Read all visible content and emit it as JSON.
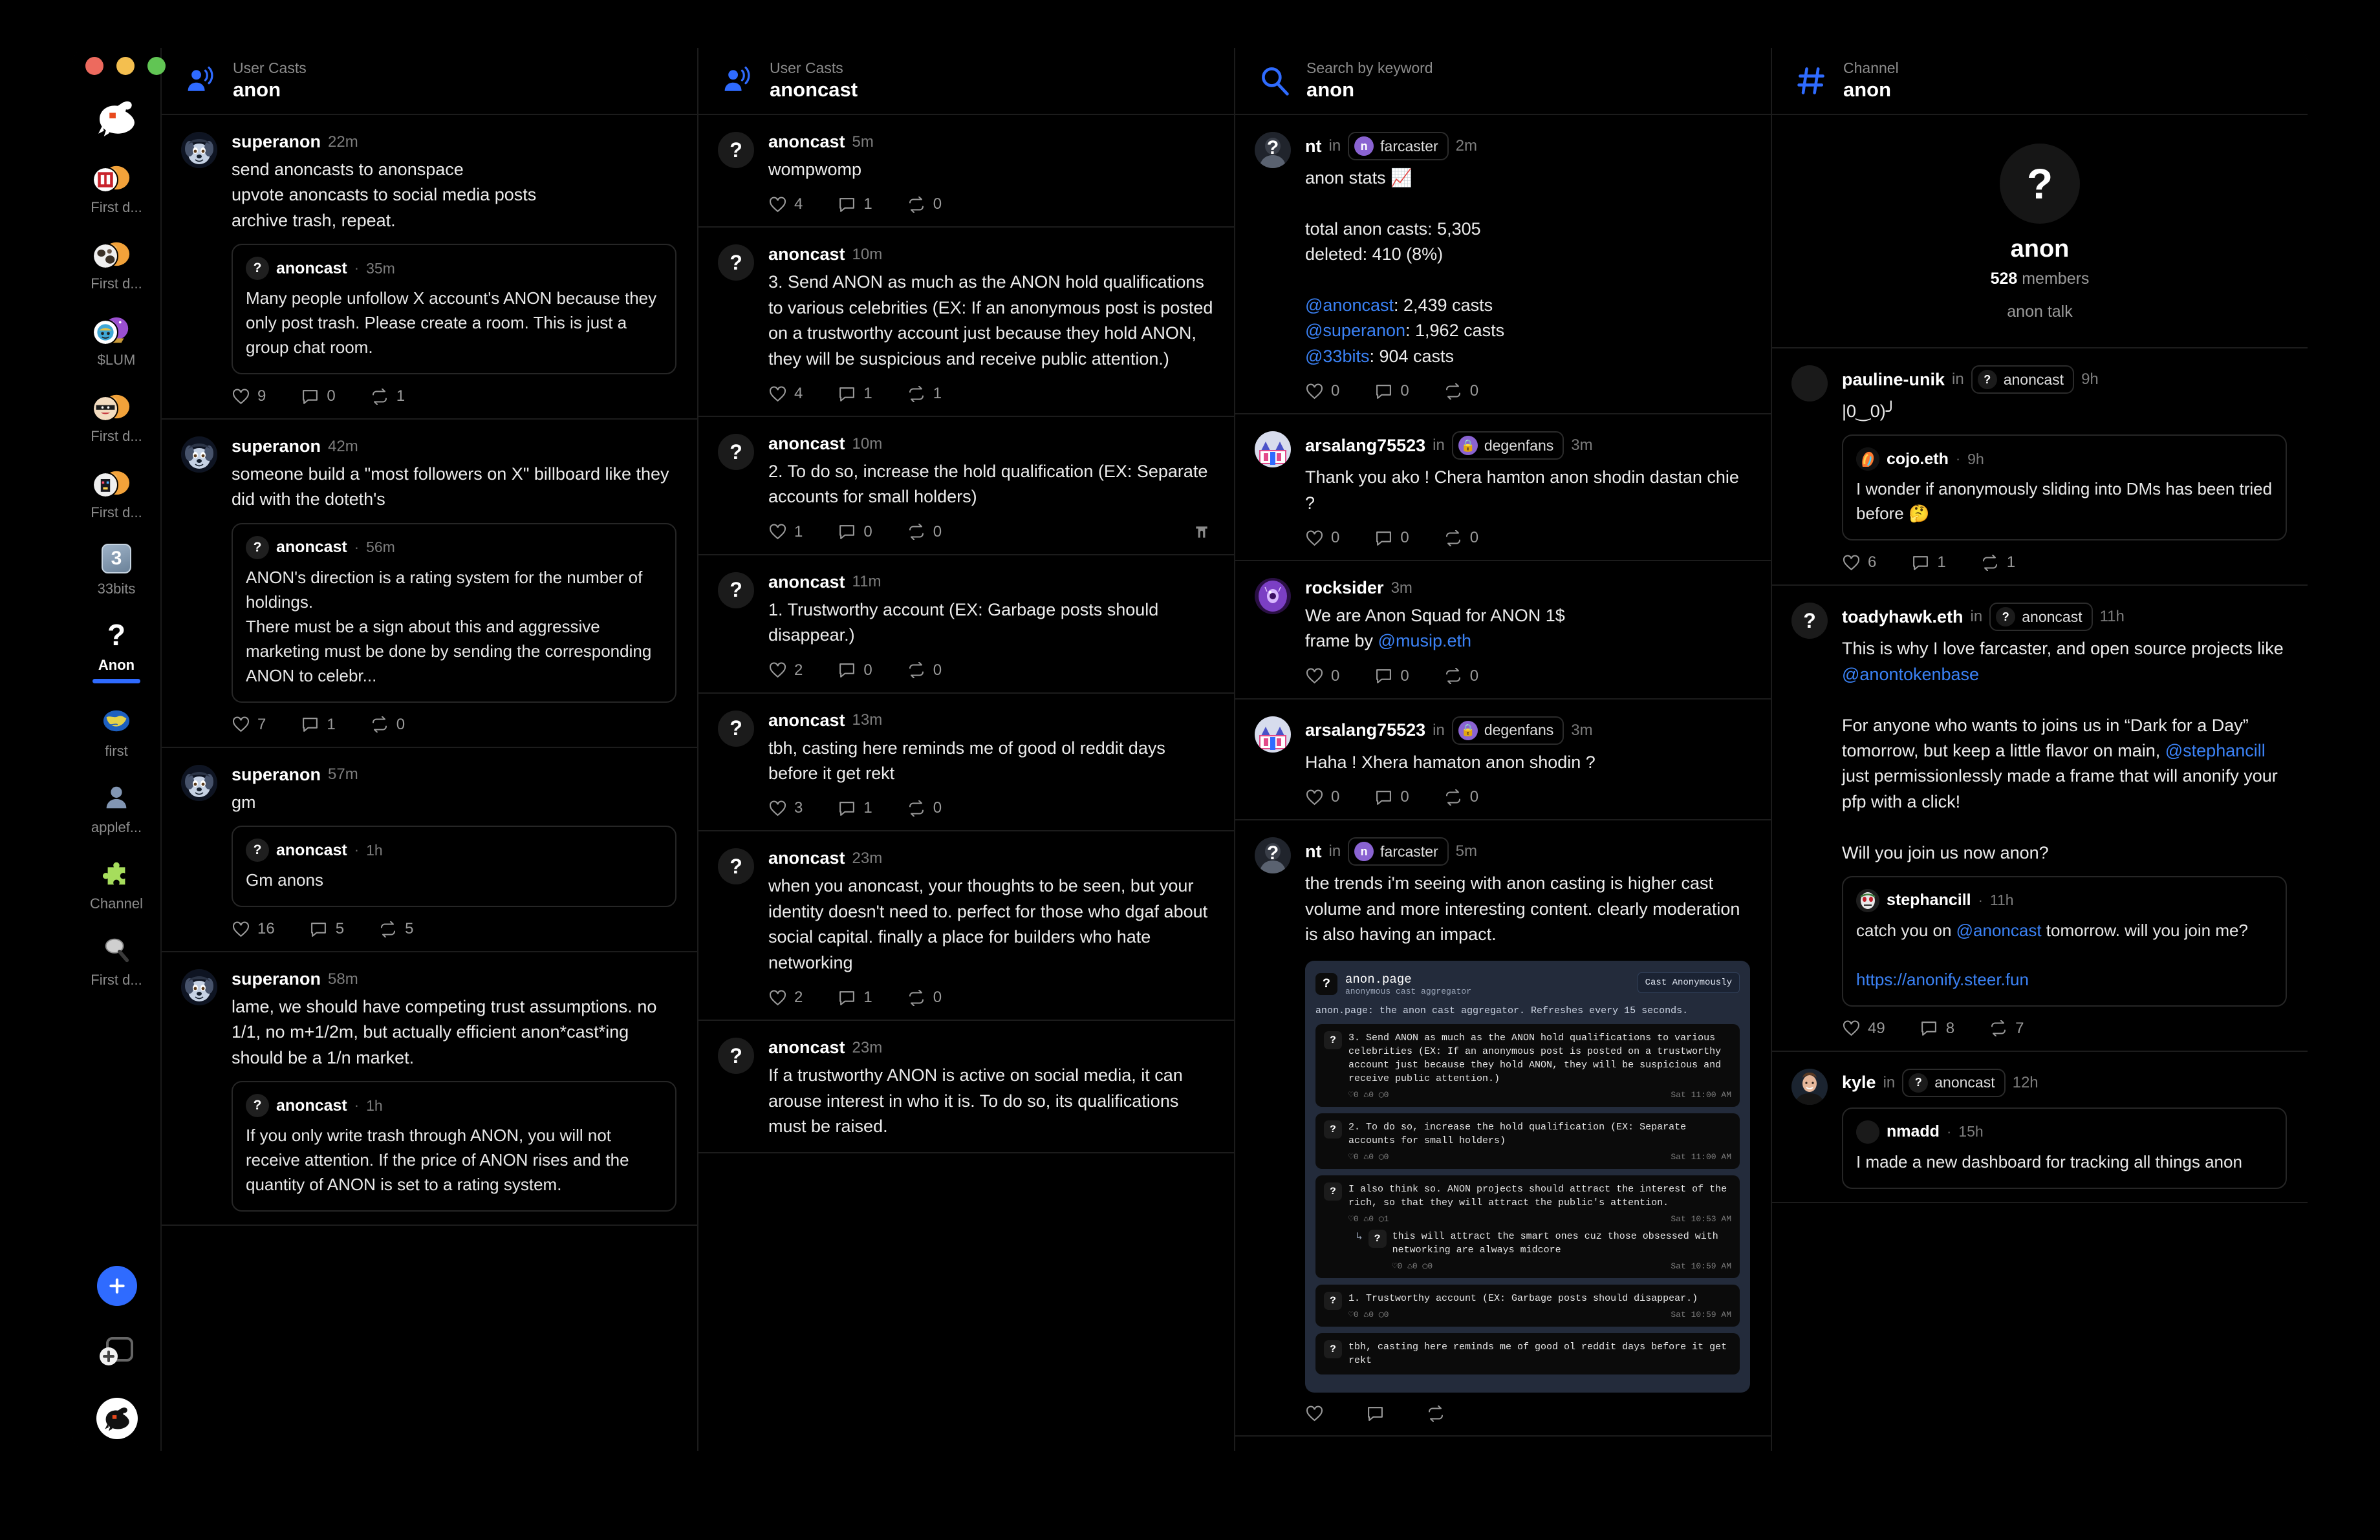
{
  "window": {
    "controls": [
      "close",
      "minimize",
      "zoom"
    ]
  },
  "theme": {
    "accent": "#2f6bff",
    "link": "#3b82f6",
    "bg": "#000000",
    "panel": "#0a0a0a",
    "border": "#1c1c1c"
  },
  "sidebar": {
    "logo_name": "goat-logo",
    "items": [
      {
        "label": "First d...",
        "icon": "orange-oval",
        "badge": "stamp-avatar",
        "active": false
      },
      {
        "label": "First d...",
        "icon": "orange-oval",
        "badge": "cow-avatar",
        "active": false
      },
      {
        "label": "$LUM",
        "icon": "crystal-ball",
        "badge": "face-avatar",
        "active": false
      },
      {
        "label": "First d...",
        "icon": "orange-oval",
        "badge": "ninja-avatar",
        "active": false
      },
      {
        "label": "First d...",
        "icon": "orange-oval",
        "badge": "pixel-avatar",
        "active": false
      },
      {
        "label": "33bits",
        "icon": "square-3",
        "badge": "",
        "active": false
      },
      {
        "label": "Anon",
        "icon": "question-mark",
        "badge": "",
        "active": true
      },
      {
        "label": "first",
        "icon": "globe",
        "badge": "",
        "active": false
      },
      {
        "label": "applef...",
        "icon": "person-silhouette",
        "badge": "",
        "active": false
      },
      {
        "label": "Channel",
        "icon": "puzzle-piece",
        "badge": "",
        "active": false
      },
      {
        "label": "First d...",
        "icon": "magnifier",
        "badge": "",
        "active": false
      }
    ],
    "bottom": {
      "add_label": "+",
      "new_window_name": "new-window-icon",
      "profile_name": "goat-profile-avatar"
    }
  },
  "columns": [
    {
      "header": {
        "kind": "User Casts",
        "title": "anon",
        "icon": "user-casts-icon"
      },
      "casts": [
        {
          "author": "superanon",
          "time": "22m",
          "avatar": "dog-avatar",
          "text": "send anoncasts to anonspace\nupvote anoncasts to social media posts\narchive trash, repeat.",
          "quote": {
            "author": "anoncast",
            "time": "35m",
            "avatar": "question",
            "text": "Many people unfollow X account's ANON because they only post trash. Please create a room. This is just a group chat room."
          },
          "likes": "9",
          "replies": "0",
          "recasts": "1"
        },
        {
          "author": "superanon",
          "time": "42m",
          "avatar": "dog-avatar",
          "text": "someone build a \"most followers on X\" billboard like they did with the doteth's",
          "quote": {
            "author": "anoncast",
            "time": "56m",
            "avatar": "question",
            "text": "ANON's direction is a rating system for the number of holdings.\nThere must be a sign about this and aggressive marketing must be done by sending the corresponding ANON to celebr..."
          },
          "likes": "7",
          "replies": "1",
          "recasts": "0"
        },
        {
          "author": "superanon",
          "time": "57m",
          "avatar": "dog-avatar",
          "text": "gm",
          "quote": {
            "author": "anoncast",
            "time": "1h",
            "avatar": "question",
            "text": "Gm anons"
          },
          "likes": "16",
          "replies": "5",
          "recasts": "5"
        },
        {
          "author": "superanon",
          "time": "58m",
          "avatar": "dog-avatar",
          "text": "lame, we should have competing trust assumptions. no 1/1, no m+1/2m, but actually efficient anon*cast*ing should be a 1/n market.",
          "quote": {
            "author": "anoncast",
            "time": "1h",
            "avatar": "question",
            "text": "If you only write trash through ANON, you will not receive attention. If the price of ANON rises and the quantity of ANON is set to a rating system."
          },
          "likes": "",
          "replies": "",
          "recasts": ""
        }
      ]
    },
    {
      "header": {
        "kind": "User Casts",
        "title": "anoncast",
        "icon": "user-casts-icon"
      },
      "casts": [
        {
          "author": "anoncast",
          "time": "5m",
          "avatar": "question",
          "text": "wompwomp",
          "likes": "4",
          "replies": "1",
          "recasts": "0"
        },
        {
          "author": "anoncast",
          "time": "10m",
          "avatar": "question",
          "text": "3. Send ANON as much as the ANON hold qualifications to various celebrities (EX: If an anonymous post is posted on a trustworthy account just because they hold ANON, they will be suspicious and receive public attention.)",
          "likes": "4",
          "replies": "1",
          "recasts": "1"
        },
        {
          "author": "anoncast",
          "time": "10m",
          "avatar": "question",
          "text": "2. To do so, increase the hold qualification (EX: Separate accounts for small holders)",
          "likes": "1",
          "replies": "0",
          "recasts": "0",
          "end_icon": "farcaster-arch-icon"
        },
        {
          "author": "anoncast",
          "time": "11m",
          "avatar": "question",
          "text": "1. Trustworthy account (EX: Garbage posts should disappear.)",
          "likes": "2",
          "replies": "0",
          "recasts": "0"
        },
        {
          "author": "anoncast",
          "time": "13m",
          "avatar": "question",
          "text": "tbh, casting here reminds me of good ol reddit days before it get rekt",
          "likes": "3",
          "replies": "1",
          "recasts": "0"
        },
        {
          "author": "anoncast",
          "time": "23m",
          "avatar": "question",
          "text": "when you anoncast, your thoughts to be seen, but your identity doesn't need to. perfect for those who dgaf about social capital. finally a place for builders who hate networking",
          "likes": "2",
          "replies": "1",
          "recasts": "0"
        },
        {
          "author": "anoncast",
          "time": "23m",
          "avatar": "question",
          "text": "If a trustworthy ANON is active on social media, it can arouse interest in who it is. To do so, its qualifications must be raised.",
          "likes": "",
          "replies": "",
          "recasts": ""
        }
      ]
    },
    {
      "header": {
        "kind": "Search by keyword",
        "title": "anon",
        "icon": "search-icon"
      },
      "casts": [
        {
          "author": "nt",
          "time": "2m",
          "avatar": "person-question",
          "in": "in",
          "channel": {
            "label": "farcaster",
            "icon": "farcaster-purple"
          },
          "text": "anon stats 📈\n\ntotal anon casts: 5,305\ndeleted: 410 (8%)\n\n@anoncast: 2,439 casts\n@superanon: 1,962 casts\n@33bits: 904 casts",
          "mentions": [
            "@anoncast",
            "@superanon",
            "@33bits"
          ],
          "likes": "0",
          "replies": "0",
          "recasts": "0"
        },
        {
          "author": "arsalang75523",
          "time": "3m",
          "avatar": "castle-pixel",
          "in": "in",
          "channel": {
            "label": "degenfans",
            "icon": "degen-lock"
          },
          "text": "Thank you ako ! Chera hamton anon shodin dastan chie ?",
          "likes": "0",
          "replies": "0",
          "recasts": "0"
        },
        {
          "author": "rocksider",
          "time": "3m",
          "avatar": "purple-eye",
          "text": "We are Anon Squad for ANON 1$\nframe by @musip.eth",
          "mentions": [
            "@musip.eth"
          ],
          "likes": "0",
          "replies": "0",
          "recasts": "0"
        },
        {
          "author": "arsalang75523",
          "time": "3m",
          "avatar": "castle-pixel",
          "in": "in",
          "channel": {
            "label": "degenfans",
            "icon": "degen-lock"
          },
          "text": "Haha ! Xhera hamaton anon shodin ?",
          "likes": "0",
          "replies": "0",
          "recasts": "0"
        },
        {
          "author": "nt",
          "time": "5m",
          "avatar": "person-question",
          "in": "in",
          "channel": {
            "label": "farcaster",
            "icon": "farcaster-purple"
          },
          "text": "the trends i'm seeing with anon casting is higher cast volume and more interesting content. clearly moderation is also having an impact.",
          "embed": {
            "site_title": "anon.page",
            "site_sub": "anonymous cast aggregator",
            "button": "Cast Anonymously",
            "note": "anon.page: the anon cast aggregator. Refreshes every 15 seconds.",
            "items": [
              {
                "text": "3. Send ANON as much as the ANON hold qualifications to various celebrities (EX: If an anonymous post is posted on a trustworthy account just because they hold ANON, they will be suspicious and receive public attention.)",
                "stats": "♡0 ♺0 ◯0",
                "time": "Sat 11:00 AM"
              },
              {
                "text": "2. To do so, increase the hold qualification (EX: Separate accounts for small holders)",
                "stats": "♡0 ♺0 ◯0",
                "time": "Sat 11:00 AM"
              },
              {
                "text": "I also think so. ANON projects should attract the interest of the rich, so that they will attract the public's attention.",
                "stats": "♡0 ♺0 ◯1",
                "time": "Sat 10:53 AM",
                "reply": {
                  "text": "this will attract the smart ones cuz those obsessed with networking are always midcore",
                  "stats": "♡0 ♺0 ◯0",
                  "time": "Sat 10:59 AM"
                }
              },
              {
                "text": "1. Trustworthy account (EX: Garbage posts should disappear.)",
                "stats": "♡0 ♺0 ◯0",
                "time": "Sat 10:59 AM"
              },
              {
                "text": "tbh, casting here reminds me of good ol reddit days before it get rekt",
                "stats": "",
                "time": ""
              }
            ]
          }
        }
      ]
    },
    {
      "header": {
        "kind": "Channel",
        "title": "anon",
        "icon": "hash-icon"
      },
      "hero": {
        "avatar": "question",
        "name": "anon",
        "members_count": "528",
        "members_label": "members",
        "description": "anon talk"
      },
      "casts": [
        {
          "author": "pauline-unik",
          "time": "9h",
          "avatar": "dark-blank",
          "in": "in",
          "channel": {
            "label": "anoncast",
            "icon": "question-chip"
          },
          "text": "|0‿0)╯",
          "quote": {
            "author": "cojo.eth",
            "time": "9h",
            "avatar": "rainbow-face",
            "text": "I wonder if anonymously sliding into DMs has been tried before 🤔"
          },
          "likes": "6",
          "replies": "1",
          "recasts": "1"
        },
        {
          "author": "toadyhawk.eth",
          "time": "11h",
          "avatar": "question",
          "in": "in",
          "channel": {
            "label": "anoncast",
            "icon": "question-chip"
          },
          "text": "This is why I love farcaster, and open source projects like @anontokenbase\n\nFor anyone who wants to joins us in “Dark for a Day” tomorrow, but keep a little flavor on main, @stephancill just permissionlessly made a frame that will anonify your pfp with a click!\n\nWill you join us now anon?",
          "mentions": [
            "@anontokenbase",
            "@stephancill"
          ],
          "quote": {
            "author": "stephancill",
            "time": "11h",
            "avatar": "mask-avatar",
            "text": "catch you on @anoncast tomorrow. will you join me?\n\nhttps://anonify.steer.fun",
            "mentions": [
              "@anoncast"
            ],
            "links": [
              "https://anonify.steer.fun"
            ]
          },
          "likes": "49",
          "replies": "8",
          "recasts": "7"
        },
        {
          "author": "kyle",
          "time": "12h",
          "avatar": "man-photo",
          "in": "in",
          "channel": {
            "label": "anoncast",
            "icon": "question-chip"
          },
          "text": "",
          "quote": {
            "author": "nmadd",
            "time": "15h",
            "avatar": "dark-blank",
            "text": "I made a new dashboard for tracking all things anon"
          },
          "likes": "",
          "replies": "",
          "recasts": ""
        }
      ]
    }
  ]
}
